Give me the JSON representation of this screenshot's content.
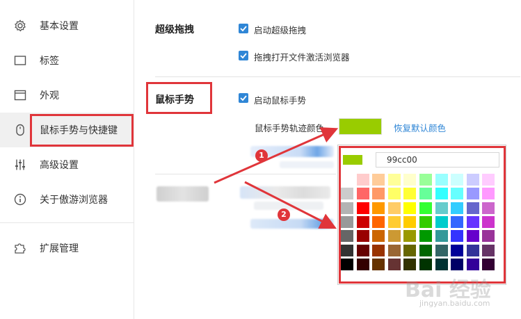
{
  "sidebar": {
    "items": [
      {
        "label": "基本设置",
        "icon": "gear-icon"
      },
      {
        "label": "标签",
        "icon": "tab-icon"
      },
      {
        "label": "外观",
        "icon": "window-icon"
      },
      {
        "label": "鼠标手势与快捷键",
        "icon": "mouse-icon"
      },
      {
        "label": "高级设置",
        "icon": "sliders-icon"
      },
      {
        "label": "关于傲游浏览器",
        "icon": "info-icon"
      },
      {
        "label": "扩展管理",
        "icon": "puzzle-icon"
      }
    ],
    "active_index": 3
  },
  "super_drag": {
    "title": "超级拖拽",
    "options": [
      "启动超级拖拽",
      "拖拽打开文件激活浏览器"
    ]
  },
  "mouse_gesture": {
    "title": "鼠标手势",
    "enable_label": "启动鼠标手势",
    "trail_color_label": "鼠标手势轨迹颜色",
    "trail_color": "#99cc00",
    "reset_label": "恢复默认颜色"
  },
  "color_picker": {
    "hex_value": "99cc00",
    "columns": [
      [
        "#ffffff",
        "#cccccc",
        "#b3b3b3",
        "#999999",
        "#666666",
        "#333333",
        "#000000"
      ],
      [
        "#ffcccc",
        "#ff6666",
        "#ff0000",
        "#cc0000",
        "#990000",
        "#660000",
        "#330000"
      ],
      [
        "#ffcc99",
        "#ff9966",
        "#ff9900",
        "#ff6600",
        "#cc6600",
        "#993300",
        "#663300"
      ],
      [
        "#ffff99",
        "#ffff66",
        "#ffcc66",
        "#ffcc33",
        "#cc9933",
        "#996633",
        "#663333"
      ],
      [
        "#ffffcc",
        "#ffff33",
        "#ffff00",
        "#ffcc00",
        "#999900",
        "#666600",
        "#333300"
      ],
      [
        "#99ff99",
        "#66ff99",
        "#33ff33",
        "#33cc00",
        "#009900",
        "#006600",
        "#003300"
      ],
      [
        "#99ffff",
        "#33ffff",
        "#66cccc",
        "#00cccc",
        "#339999",
        "#336666",
        "#003333"
      ],
      [
        "#ccffff",
        "#66ffff",
        "#33ccff",
        "#3366ff",
        "#3333ff",
        "#000099",
        "#000066"
      ],
      [
        "#ccccff",
        "#9999ff",
        "#6666cc",
        "#6633ff",
        "#6600cc",
        "#333399",
        "#330099"
      ],
      [
        "#ffccff",
        "#ff99ff",
        "#cc66cc",
        "#cc33cc",
        "#993399",
        "#663366",
        "#330033"
      ]
    ]
  },
  "annotations": {
    "badge_1": "1",
    "badge_2": "2",
    "accent": "#e0353a"
  },
  "watermark": {
    "text": "Bai 经验",
    "sub": "jingyan.baidu.com"
  }
}
